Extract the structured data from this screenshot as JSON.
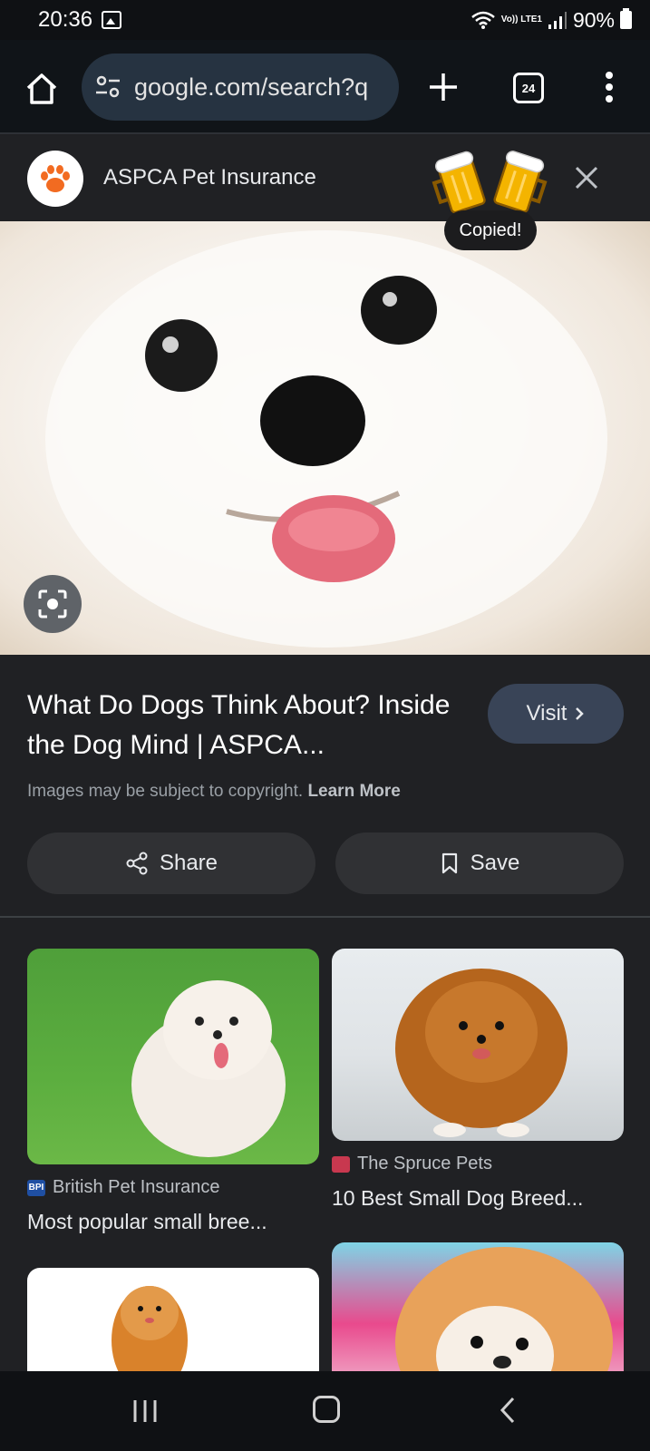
{
  "status_bar": {
    "time": "20:36",
    "network": "Vo)) LTE1",
    "battery": "90%"
  },
  "browser": {
    "url": "google.com/search?q",
    "tab_count": "24"
  },
  "site_bar": {
    "name": "ASPCA Pet Insurance"
  },
  "toast": {
    "text": "Copied!"
  },
  "result": {
    "title": "What Do Dogs Think About? Inside the Dog Mind | ASPCA...",
    "visit_label": "Visit",
    "copyright_text": "Images may be subject to copyright.",
    "learn_more": "Learn More",
    "share_label": "Share",
    "save_label": "Save"
  },
  "related": [
    {
      "source": "British Pet Insurance",
      "title": "Most popular small bree..."
    },
    {
      "source": "The Spruce Pets",
      "title": "10 Best Small Dog Breed..."
    }
  ],
  "colors": {
    "background": "#202124",
    "accent": "#394457",
    "url_box": "#263341"
  },
  "icons": [
    "home-icon",
    "tune-icon",
    "plus-icon",
    "tabs-icon",
    "more-vert-icon",
    "paw-icon",
    "beer-mugs-icon",
    "close-icon",
    "lens-icon",
    "chevron-right-icon",
    "share-icon",
    "bookmark-icon",
    "recents-icon",
    "home-nav-icon",
    "back-icon"
  ]
}
